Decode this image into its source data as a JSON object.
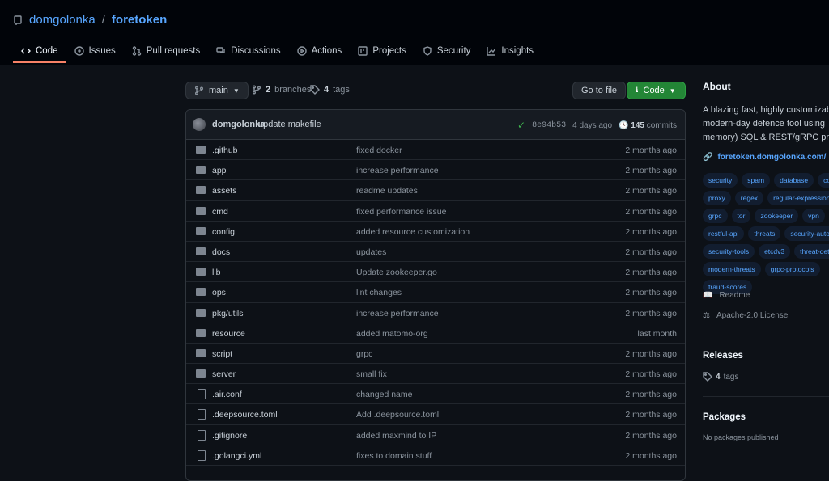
{
  "repo": {
    "owner": "domgolonka",
    "separator": "/",
    "name": "foretoken"
  },
  "tabs": [
    {
      "label": "Code",
      "icon": "code-icon",
      "active": true
    },
    {
      "label": "Issues",
      "icon": "issue-icon"
    },
    {
      "label": "Pull requests",
      "icon": "pull-request-icon"
    },
    {
      "label": "Discussions",
      "icon": "discussion-icon"
    },
    {
      "label": "Actions",
      "icon": "play-icon"
    },
    {
      "label": "Projects",
      "icon": "project-icon"
    },
    {
      "label": "Security",
      "icon": "shield-icon"
    },
    {
      "label": "Insights",
      "icon": "graph-icon"
    }
  ],
  "branchbar": {
    "branch": "main",
    "branches_count": "2",
    "branches_label": "branches",
    "tags_count": "4",
    "tags_label": "tags",
    "goto_file": "Go to file",
    "code_button": "Code"
  },
  "commit": {
    "author": "domgolonka",
    "message": "update makefile",
    "hash": "8e94b53",
    "age": "4 days ago",
    "count": "145",
    "count_label": "commits"
  },
  "files": [
    {
      "type": "dir",
      "name": ".github",
      "message": "fixed docker",
      "age": "2 months ago"
    },
    {
      "type": "dir",
      "name": "app",
      "message": "increase performance",
      "age": "2 months ago"
    },
    {
      "type": "dir",
      "name": "assets",
      "message": "readme updates",
      "age": "2 months ago"
    },
    {
      "type": "dir",
      "name": "cmd",
      "message": "fixed performance issue",
      "age": "2 months ago"
    },
    {
      "type": "dir",
      "name": "config",
      "message": "added resource customization",
      "age": "2 months ago"
    },
    {
      "type": "dir",
      "name": "docs",
      "message": "updates",
      "age": "2 months ago"
    },
    {
      "type": "dir",
      "name": "lib",
      "message": "Update zookeeper.go",
      "age": "2 months ago"
    },
    {
      "type": "dir",
      "name": "ops",
      "message": "lint changes",
      "age": "2 months ago"
    },
    {
      "type": "dir",
      "name": "pkg/utils",
      "message": "increase performance",
      "age": "2 months ago"
    },
    {
      "type": "dir",
      "name": "resource",
      "message": "added matomo-org",
      "age": "last month"
    },
    {
      "type": "dir",
      "name": "script",
      "message": "grpc",
      "age": "2 months ago"
    },
    {
      "type": "dir",
      "name": "server",
      "message": "small fix",
      "age": "2 months ago"
    },
    {
      "type": "file",
      "name": ".air.conf",
      "message": "changed name",
      "age": "2 months ago"
    },
    {
      "type": "file",
      "name": ".deepsource.toml",
      "message": "Add .deepsource.toml",
      "age": "2 months ago"
    },
    {
      "type": "file",
      "name": ".gitignore",
      "message": "added maxmind to IP",
      "age": "2 months ago"
    },
    {
      "type": "file",
      "name": ".golangci.yml",
      "message": "fixes to domain stuff",
      "age": "2 months ago"
    }
  ],
  "about": {
    "heading": "About",
    "desc_lines": [
      "A blazing fast, highly customizab",
      "modern-day defence tool using",
      "memory) SQL & REST/gRPC prot"
    ],
    "website": "foretoken.domgolonka.com/"
  },
  "topic_rows": [
    [
      "security",
      "spam",
      "database",
      "con"
    ],
    [
      "proxy",
      "regex",
      "regular-expression"
    ],
    [
      "grpc",
      "tor",
      "zookeeper",
      "vpn"
    ],
    [
      "restful-api",
      "threats",
      "security-autom"
    ],
    [
      "security-tools",
      "etcdv3",
      "threat-dete"
    ],
    [
      "modern-threats",
      "grpc-protocols"
    ],
    [
      "fraud-scores"
    ]
  ],
  "sidebar": {
    "readme": "Readme",
    "license": "Apache-2.0 License",
    "releases_heading": "Releases",
    "releases_count": "4",
    "releases_label": "tags",
    "packages_heading": "Packages",
    "packages_text": "No packages published"
  }
}
